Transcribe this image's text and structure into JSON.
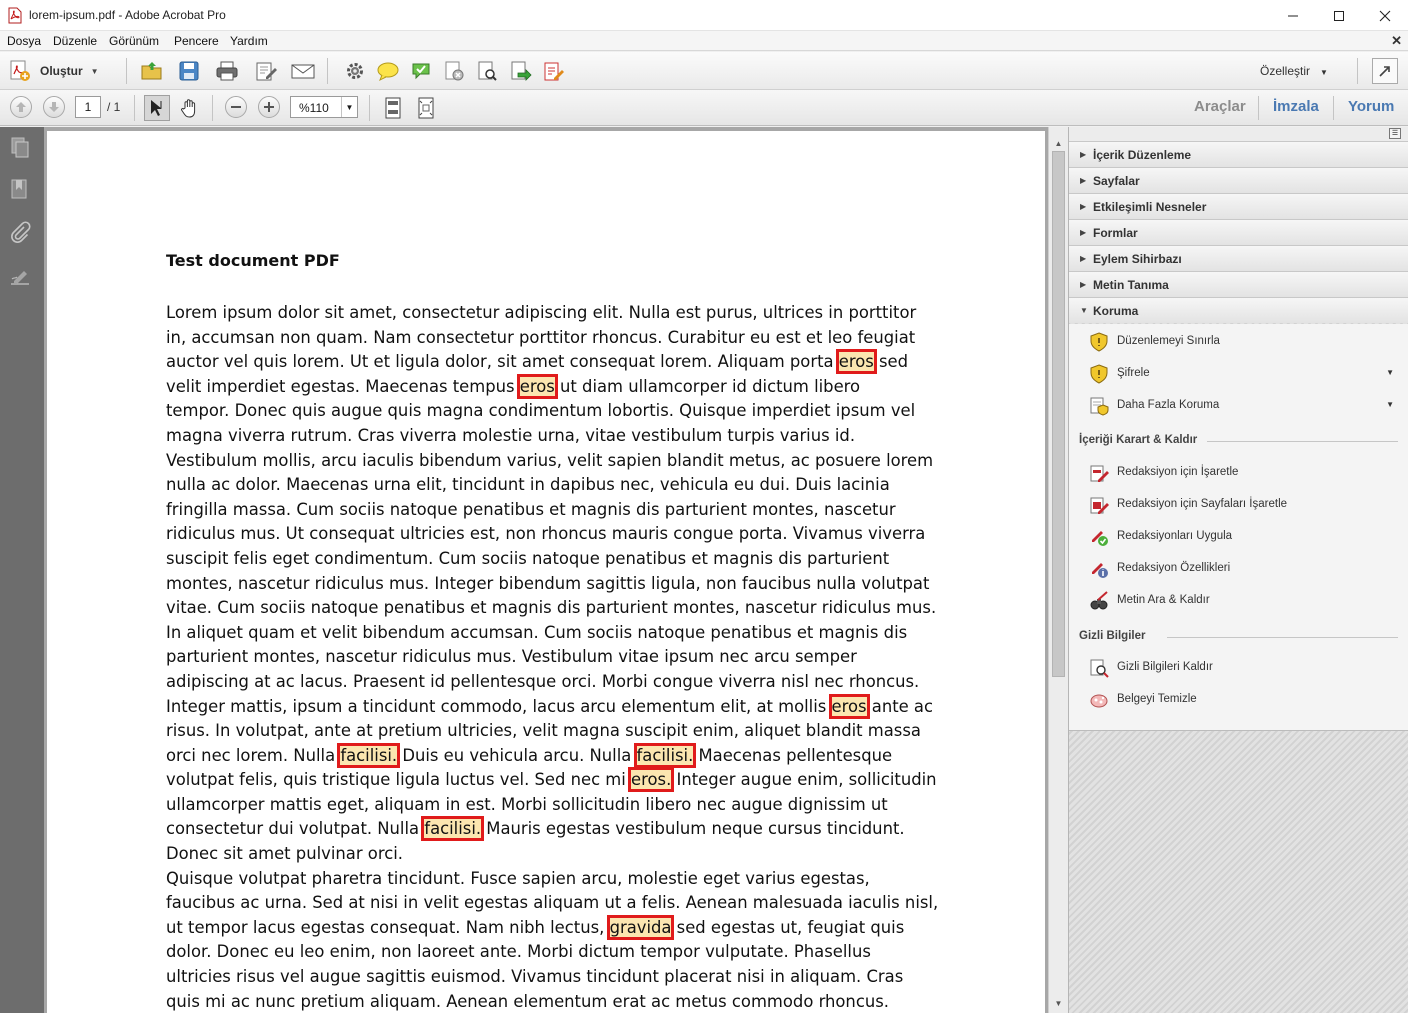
{
  "window": {
    "title": "lorem-ipsum.pdf - Adobe Acrobat Pro"
  },
  "menu": [
    "Dosya",
    "Düzenle",
    "Görünüm",
    "Pencere",
    "Yardım"
  ],
  "toolbar": {
    "create_label": "Oluştur",
    "customize_label": "Özelleştir"
  },
  "nav": {
    "current_page": "1",
    "total_pages": "/ 1",
    "zoom": "%110"
  },
  "panes": {
    "tools": "Araçlar",
    "sign": "İmzala",
    "comment": "Yorum"
  },
  "panel": {
    "sections": [
      "İçerik Düzenleme",
      "Sayfalar",
      "Etkileşimli Nesneler",
      "Formlar",
      "Eylem Sihirbazı",
      "Metin Tanıma",
      "Koruma"
    ],
    "protection_tasks": [
      "Düzenlemeyi Sınırla",
      "Şifrele",
      "Daha Fazla Koruma"
    ],
    "redact_header": "İçeriği Karart & Kaldır",
    "redact_tasks": [
      "Redaksiyon için İşaretle",
      "Redaksiyon için Sayfaları İşaretle",
      "Redaksiyonları Uygula",
      "Redaksiyon Özellikleri",
      "Metin Ara & Kaldır"
    ],
    "hidden_header": "Gizli Bilgiler",
    "hidden_tasks": [
      "Gizli Bilgileri Kaldır",
      "Belgeyi Temizle"
    ]
  },
  "document": {
    "title": "Test document PDF",
    "lines": [
      [
        {
          "t": "Lorem ipsum dolor sit amet, consectetur adipiscing elit. Nulla est purus, ultrices in porttitor"
        }
      ],
      [
        {
          "t": "in, accumsan non quam. Nam consectetur porttitor rhoncus. Curabitur eu est et leo feugiat"
        }
      ],
      [
        {
          "t": "auctor vel quis lorem. Ut et ligula dolor, sit amet consequat lorem. Aliquam porta "
        },
        {
          "t": "eros",
          "hl": true
        },
        {
          "t": " sed"
        }
      ],
      [
        {
          "t": "velit imperdiet egestas. Maecenas tempus "
        },
        {
          "t": "eros",
          "hl": true
        },
        {
          "t": " ut diam ullamcorper id dictum libero"
        }
      ],
      [
        {
          "t": "tempor. Donec quis augue quis magna condimentum lobortis. Quisque imperdiet ipsum vel"
        }
      ],
      [
        {
          "t": "magna viverra rutrum. Cras viverra molestie urna, vitae vestibulum turpis varius id."
        }
      ],
      [
        {
          "t": "Vestibulum mollis, arcu iaculis bibendum varius, velit sapien blandit metus, ac posuere lorem"
        }
      ],
      [
        {
          "t": "nulla ac dolor. Maecenas urna elit, tincidunt in dapibus nec, vehicula eu dui. Duis lacinia"
        }
      ],
      [
        {
          "t": "fringilla massa. Cum sociis natoque penatibus et magnis dis parturient montes, nascetur"
        }
      ],
      [
        {
          "t": "ridiculus mus. Ut consequat ultricies est, non rhoncus mauris congue porta. Vivamus viverra"
        }
      ],
      [
        {
          "t": "suscipit felis eget condimentum. Cum sociis natoque penatibus et magnis dis parturient"
        }
      ],
      [
        {
          "t": "montes, nascetur ridiculus mus. Integer bibendum sagittis ligula, non faucibus nulla volutpat"
        }
      ],
      [
        {
          "t": "vitae. Cum sociis natoque penatibus et magnis dis parturient montes, nascetur ridiculus mus."
        }
      ],
      [
        {
          "t": "In aliquet quam et velit bibendum accumsan. Cum sociis natoque penatibus et magnis dis"
        }
      ],
      [
        {
          "t": "parturient montes, nascetur ridiculus mus. Vestibulum vitae ipsum nec arcu semper"
        }
      ],
      [
        {
          "t": "adipiscing at ac lacus. Praesent id pellentesque orci. Morbi congue viverra nisl nec rhoncus."
        }
      ],
      [
        {
          "t": "Integer mattis, ipsum a tincidunt commodo, lacus arcu elementum elit, at mollis "
        },
        {
          "t": "eros",
          "hl": true
        },
        {
          "t": " ante ac"
        }
      ],
      [
        {
          "t": "risus. In volutpat, ante at pretium ultricies, velit magna suscipit enim, aliquet blandit massa"
        }
      ],
      [
        {
          "t": "orci nec lorem. Nulla "
        },
        {
          "t": "facilisi.",
          "hl": true
        },
        {
          "t": " Duis eu vehicula arcu. Nulla "
        },
        {
          "t": "facilisi.",
          "hl": true
        },
        {
          "t": " Maecenas pellentesque"
        }
      ],
      [
        {
          "t": "volutpat felis, quis tristique ligula luctus vel. Sed nec mi "
        },
        {
          "t": "eros.",
          "hl": true
        },
        {
          "t": " Integer augue enim, sollicitudin"
        }
      ],
      [
        {
          "t": "ullamcorper mattis eget, aliquam in est. Morbi sollicitudin libero nec augue dignissim ut"
        }
      ],
      [
        {
          "t": "consectetur dui volutpat. Nulla "
        },
        {
          "t": "facilisi.",
          "hl": true
        },
        {
          "t": " Mauris egestas vestibulum neque cursus tincidunt."
        }
      ],
      [
        {
          "t": "Donec sit amet pulvinar orci."
        }
      ],
      [
        {
          "t": "Quisque volutpat pharetra tincidunt. Fusce sapien arcu, molestie eget varius egestas,"
        }
      ],
      [
        {
          "t": "faucibus ac urna. Sed at nisi in velit egestas aliquam ut a felis. Aenean malesuada iaculis nisl,"
        }
      ],
      [
        {
          "t": "ut tempor lacus egestas consequat. Nam nibh lectus, "
        },
        {
          "t": "gravida",
          "hl": true
        },
        {
          "t": " sed egestas ut, feugiat quis"
        }
      ],
      [
        {
          "t": "dolor. Donec eu leo enim, non laoreet ante. Morbi dictum tempor vulputate. Phasellus"
        }
      ],
      [
        {
          "t": "ultricies risus vel augue sagittis euismod. Vivamus tincidunt placerat nisi in aliquam. Cras"
        }
      ],
      [
        {
          "t": "quis mi ac nunc pretium aliquam. Aenean elementum erat ac metus commodo rhoncus."
        }
      ]
    ]
  }
}
